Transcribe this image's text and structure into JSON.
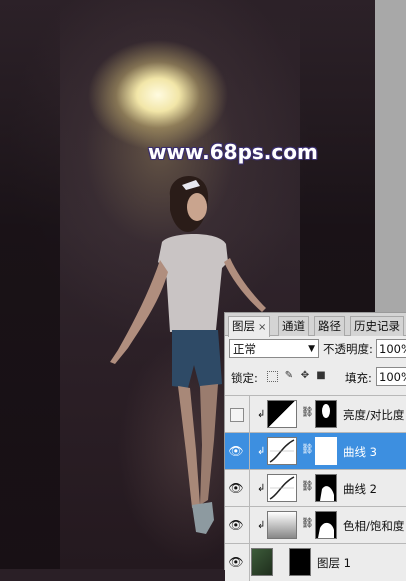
{
  "watermark": "www.68ps.com",
  "panel": {
    "tabs": [
      "图层",
      "通道",
      "路径",
      "历史记录"
    ],
    "tab_close": "×",
    "blend_mode": "正常",
    "opacity_label": "不透明度:",
    "opacity_value": "100%",
    "lock_label": "锁定:",
    "fill_label": "填充:",
    "fill_value": "100%",
    "layers": [
      {
        "name": "亮度/对比度",
        "visible": false,
        "selected": false,
        "icon": "brightness-contrast-icon"
      },
      {
        "name": "曲线 3",
        "visible": true,
        "selected": true,
        "icon": "curves-icon"
      },
      {
        "name": "曲线 2",
        "visible": true,
        "selected": false,
        "icon": "curves-icon"
      },
      {
        "name": "色相/饱和度",
        "visible": true,
        "selected": false,
        "icon": "hue-saturation-icon"
      },
      {
        "name": "图层 1",
        "visible": true,
        "selected": false,
        "icon": "image-thumbnail"
      }
    ]
  },
  "colors": {
    "selection": "#3d8fe0",
    "panel_bg": "#ececec",
    "watermark_outline": "#3b2f6f"
  }
}
